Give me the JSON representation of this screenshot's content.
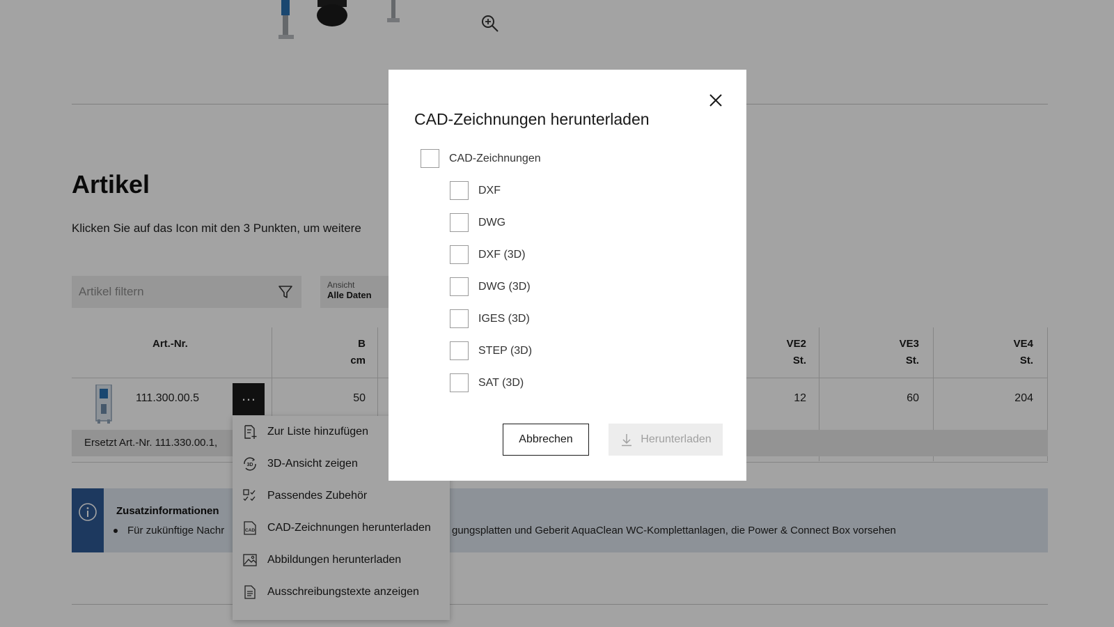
{
  "section": {
    "title": "Artikel",
    "description": "Klicken Sie auf das Icon mit den 3 Punkten, um weitere"
  },
  "filter": {
    "placeholder": "Artikel filtern"
  },
  "view_select": {
    "label": "Ansicht",
    "value": "Alle Daten"
  },
  "table": {
    "headers": {
      "art_nr": "Art.-Nr.",
      "b": "B",
      "b_unit": "cm",
      "ve2": "VE2",
      "ve2_unit": "St.",
      "ve3": "VE3",
      "ve3_unit": "St.",
      "ve4": "VE4",
      "ve4_unit": "St."
    },
    "row": {
      "art_nr": "111.300.00.5",
      "b": "50",
      "ve2": "12",
      "ve3": "60",
      "ve4": "204"
    },
    "replaced_text": "Ersetzt Art.-Nr. 111.330.00.1,"
  },
  "info": {
    "title": "Zusatzinformationen",
    "text_start": "Für zukünftige Nachr",
    "text_end": "gungsplatten und Geberit AquaClean WC-Komplettanlagen, die Power & Connect Box vorsehen"
  },
  "context_menu": {
    "items": [
      {
        "label": "Zur Liste hinzufügen",
        "icon": "add-to-list-icon"
      },
      {
        "label": "3D-Ansicht zeigen",
        "icon": "3d-view-icon"
      },
      {
        "label": "Passendes Zubehör",
        "icon": "checklist-icon"
      },
      {
        "label": "CAD-Zeichnungen herunterladen",
        "icon": "cad-icon"
      },
      {
        "label": "Abbildungen herunterladen",
        "icon": "image-icon"
      },
      {
        "label": "Ausschreibungstexte anzeigen",
        "icon": "document-icon"
      }
    ]
  },
  "modal": {
    "title": "CAD-Zeichnungen herunterladen",
    "parent_option": "CAD-Zeichnungen",
    "options": [
      "DXF",
      "DWG",
      "DXF (3D)",
      "DWG (3D)",
      "IGES (3D)",
      "STEP (3D)",
      "SAT (3D)"
    ],
    "cancel_label": "Abbrechen",
    "download_label": "Herunterladen"
  }
}
